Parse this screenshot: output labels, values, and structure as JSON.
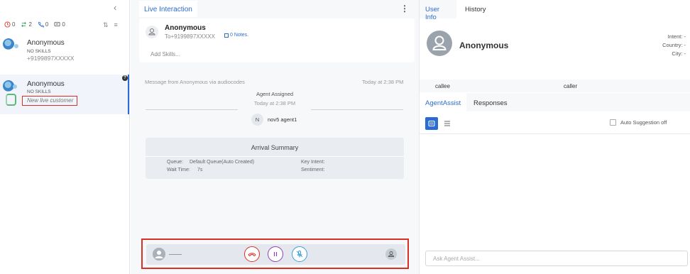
{
  "left_panel": {
    "collapse_icon": "chevron-left-icon",
    "stats": [
      {
        "icon": "clock-icon",
        "value": "0",
        "color": "#d93025"
      },
      {
        "icon": "transfer-icon",
        "value": "2",
        "color": "#2e9e5b"
      },
      {
        "icon": "phone-icon",
        "value": "0",
        "color": "#2b6cd3"
      },
      {
        "icon": "chat-icon",
        "value": "0",
        "color": "#555555"
      }
    ],
    "conversations": [
      {
        "name": "Anonymous",
        "skill": "NO SKILLS",
        "sub": "+9199897XXXXX"
      },
      {
        "name": "Anonymous",
        "skill": "NO SKILLS",
        "tag": "New live customer",
        "badge": "?"
      }
    ]
  },
  "center": {
    "tab_live": "Live Interaction",
    "contact": {
      "name": "Anonymous",
      "phone": "To+9199897XXXXX",
      "notes": "0 Notes.",
      "add_skills": "Add Skills..."
    },
    "chat": {
      "message_from": "Message from Anonymous via audiocodes",
      "message_time": "Today at 2:38 PM",
      "assigned_title": "Agent Assigned",
      "assigned_time": "Today at 2:38 PM",
      "agent_initial": "N",
      "agent_name": "nov5 agent1"
    },
    "arrival": {
      "title": "Arrival Summary",
      "queue_label": "Queue:",
      "queue_value": "Default Queue(Auto Created)",
      "wait_label": "Wait Time:",
      "wait_value": "7s",
      "intent_label": "Key Intent:",
      "sentiment_label": "Sentiment:"
    }
  },
  "right": {
    "tab_userinfo": "User Info",
    "tab_history": "History",
    "user_name": "Anonymous",
    "intent": "Intent: -",
    "country": "Country: -",
    "city": "City: -",
    "callee": "callee",
    "caller": "caller",
    "tab_agentassist": "AgentAssist",
    "tab_responses": "Responses",
    "auto_suggestion": "Auto Suggestion off",
    "ask_placeholder": "Ask Agent Assist..."
  }
}
